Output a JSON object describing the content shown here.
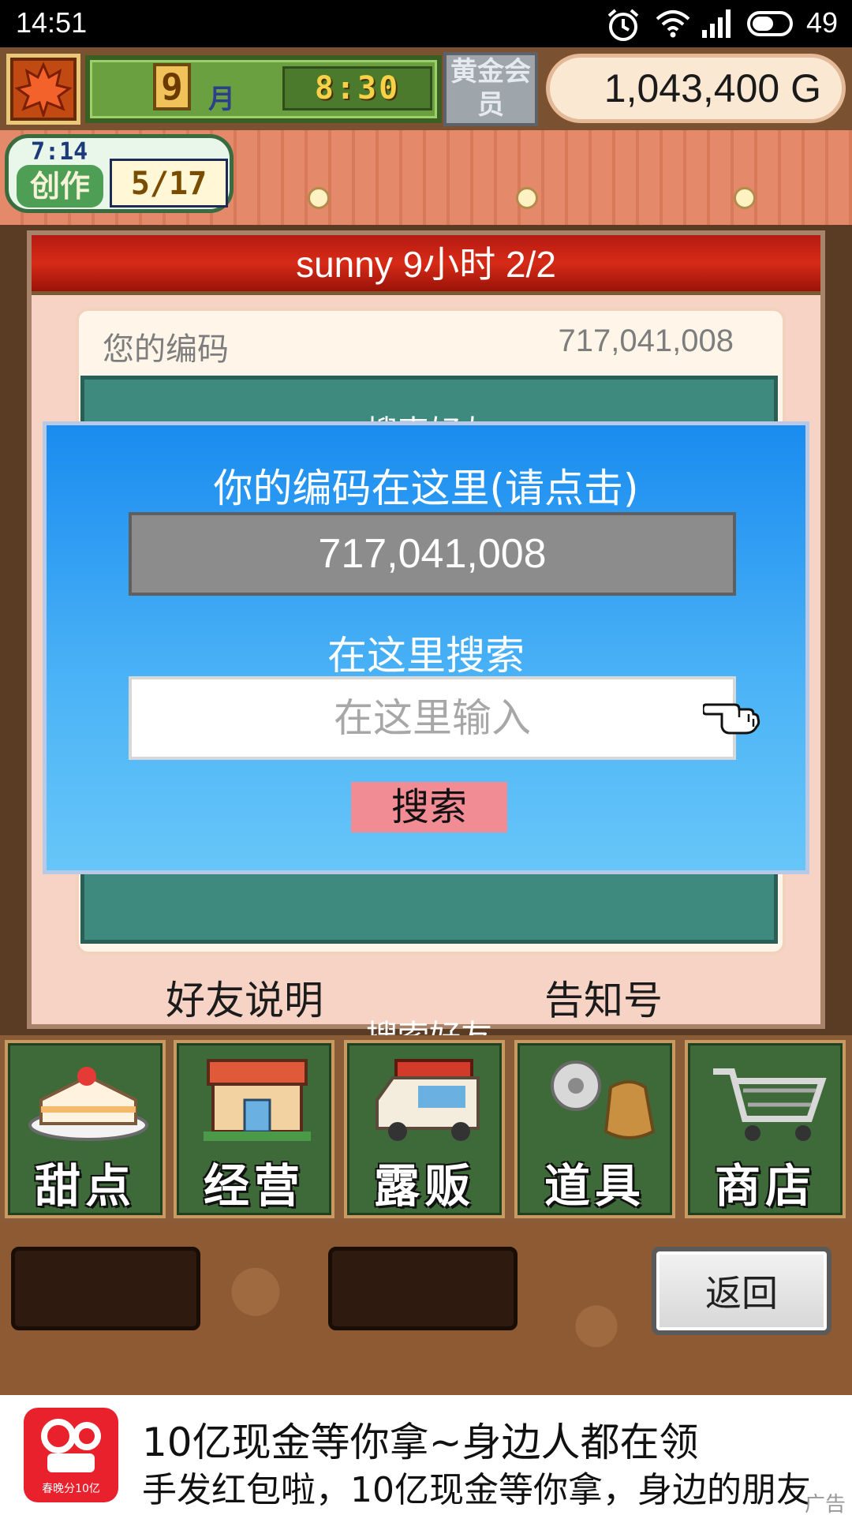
{
  "status_bar": {
    "time": "14:51",
    "battery": "49",
    "icons": [
      "alarm-icon",
      "wifi-icon",
      "signal-icon",
      "battery-icon"
    ]
  },
  "hud": {
    "month_number": "9",
    "month_label": "月",
    "clock": "8:30",
    "vip_label": "黄金会员",
    "gold": "1,043,400 G"
  },
  "create_panel": {
    "timer": "7:14",
    "label": "创作",
    "count": "5/17"
  },
  "friend_window": {
    "header": "sunny  9小时 2/2",
    "your_code_label": "您的编码",
    "your_code_value": "717,041,008",
    "search_friend_top": "搜索好友",
    "search_friend_bottom": "搜索好友",
    "friend_help": "好友说明",
    "notice": "告知号"
  },
  "search_dialog": {
    "title": "你的编码在这里(请点击)",
    "code": "717,041,008",
    "search_title": "在这里搜索",
    "input_placeholder": "在这里输入",
    "search_button": "搜索"
  },
  "menu": {
    "items": [
      {
        "label": "甜点",
        "icon": "cake-icon"
      },
      {
        "label": "经营",
        "icon": "shop-building-icon"
      },
      {
        "label": "露贩",
        "icon": "food-truck-icon"
      },
      {
        "label": "道具",
        "icon": "gear-bag-icon"
      },
      {
        "label": "商店",
        "icon": "shopping-cart-icon"
      }
    ]
  },
  "back_button": "返回",
  "ad": {
    "title": "10亿现金等你拿~身边人都在领",
    "subtitle": "手发红包啦，10亿现金等你拿，身边的朋友",
    "logo_caption": "春晚分10亿",
    "tag": "广告"
  },
  "colors": {
    "dialog_top": "#1a8cf0",
    "dialog_bottom": "#66c6f8",
    "header_red": "#c8200f",
    "teal": "#3f8a7f",
    "search_button": "#f28c94"
  }
}
